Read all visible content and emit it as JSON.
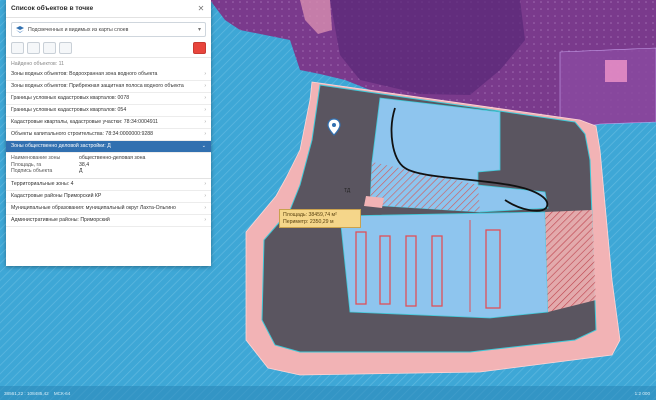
{
  "panel": {
    "title": "Список объектов в точке",
    "layer_select": "Подсвеченных и видимых из карты слоев",
    "found": "Найдено объектов: 11",
    "rows": [
      {
        "label": "Зоны водных объектов: Водоохранная зона водного объекта"
      },
      {
        "label": "Зоны водных объектов: Прибрежная защитная полоса водного объекта"
      },
      {
        "label": "Границы условных кадастровых кварталов: 0078"
      },
      {
        "label": "Границы условных кадастровых кварталов: 054"
      },
      {
        "label": "Кадастровые кварталы, кадастровые участки: 78:34:0004911"
      },
      {
        "label": "Объекты капитального строительства: 78:34:0000000:9288"
      }
    ],
    "active_row": {
      "label": "Зоны общественно деловой застройки: Д"
    },
    "attributes": [
      {
        "key": "Наименование зоны",
        "value": "общественно-деловая зона"
      },
      {
        "key": "Площадь, га",
        "value": "38,4"
      },
      {
        "key": "Подпись объекта",
        "value": "Д"
      }
    ],
    "rows_after": [
      {
        "label": "Территориальные зоны: 4"
      },
      {
        "label": "Кадастровые районы Приморский КР"
      },
      {
        "label": "Муниципальные образования: муниципальный округ Лахта-Ольгино"
      },
      {
        "label": "Административные районы: Приморский"
      }
    ]
  },
  "tooltip": {
    "area": "Площадь: 38459,74 м²",
    "perimeter": "Периметр: 2350,29 м"
  },
  "map": {
    "label_small": "ТД"
  },
  "status": {
    "coords": "38561,22 : 108485,42",
    "crs": "МСК-64",
    "scale": "1:2 000"
  },
  "colors": {
    "water": "#3ea7d6",
    "purple_zone": "#7a3a8c",
    "dark_fill": "#5a5560",
    "pink_buffer": "#f2b3b5",
    "light_blue": "#8ec5ee",
    "red_hatch": "#d9534f",
    "accent_blue": "#3170b0"
  }
}
